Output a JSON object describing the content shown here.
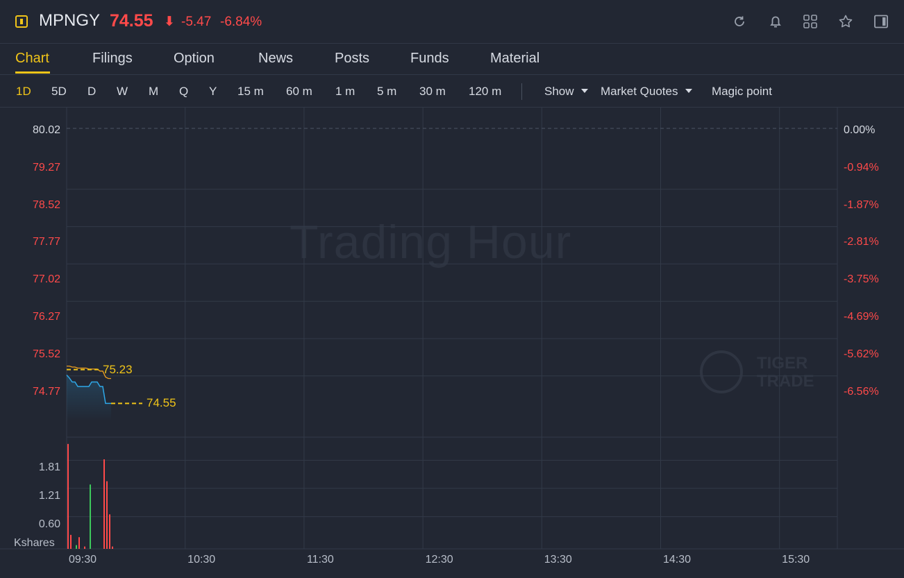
{
  "header": {
    "symbol": "MPNGY",
    "price": "74.55",
    "arrow": "⬇",
    "change": "-5.47",
    "change_pct": "-6.84%",
    "icons": [
      "refresh-icon",
      "bell-icon",
      "grid-icon",
      "star-icon",
      "panel-toggle-icon"
    ]
  },
  "tabs": [
    "Chart",
    "Filings",
    "Option",
    "News",
    "Posts",
    "Funds",
    "Material"
  ],
  "active_tab": "Chart",
  "periods": [
    "1D",
    "5D",
    "D",
    "W",
    "M",
    "Q",
    "Y",
    "15 m",
    "60 m",
    "1 m",
    "5 m",
    "30 m",
    "120 m"
  ],
  "active_period": "1D",
  "dropdowns": {
    "show": "Show",
    "market_quotes": "Market Quotes",
    "magic_point": "Magic point"
  },
  "watermark": "Trading Hour",
  "logo": {
    "line1": "TIGER",
    "line2": "TRADE"
  },
  "colors": {
    "accent": "#f0c419",
    "down": "#ff4a4a",
    "up": "#3ec95c",
    "price_line": "#2ea8e8",
    "avg_line": "#f0a020",
    "background": "#222733"
  },
  "chart_data": {
    "type": "line",
    "price_axis": {
      "labels": [
        "80.02",
        "79.27",
        "78.52",
        "77.77",
        "77.02",
        "76.27",
        "75.52",
        "74.77"
      ],
      "pct_labels": [
        "0.00%",
        "-0.94%",
        "-1.87%",
        "-2.81%",
        "-3.75%",
        "-4.69%",
        "-5.62%",
        "-6.56%"
      ],
      "reference_close": 80.02,
      "ylim": [
        74.45,
        80.3
      ]
    },
    "x_labels": [
      "09:30",
      "10:30",
      "11:30",
      "12:30",
      "13:30",
      "14:30",
      "15:30"
    ],
    "series": [
      {
        "name": "",
        "values": [
          75.12,
          75.06,
          74.98,
          74.98,
          74.89,
          74.89,
          74.89,
          74.89,
          74.89,
          74.98,
          74.98,
          74.98,
          74.89,
          74.89,
          74.55,
          74.55,
          74.55
        ],
        "last_label": "74.55"
      },
      {
        "name": "",
        "values": [
          75.3,
          75.3,
          75.28,
          75.28,
          75.26,
          75.26,
          75.26,
          75.26,
          75.24,
          75.24,
          75.24,
          75.24,
          75.2,
          75.2,
          75.08,
          75.05,
          75.05
        ],
        "last_label": "75.23"
      }
    ],
    "volume": {
      "unit_label": "Kshares",
      "labels": [
        "1.81",
        "1.21",
        "0.60"
      ],
      "ylim": [
        0,
        2.5
      ],
      "bars": [
        {
          "value": 2.25,
          "dir": "down"
        },
        {
          "value": 0.3,
          "dir": "down"
        },
        {
          "value": 0.0,
          "dir": "down"
        },
        {
          "value": 0.08,
          "dir": "up"
        },
        {
          "value": 0.25,
          "dir": "down"
        },
        {
          "value": 0.0,
          "dir": "down"
        },
        {
          "value": 0.05,
          "dir": "down"
        },
        {
          "value": 0.0,
          "dir": "down"
        },
        {
          "value": 1.38,
          "dir": "up"
        },
        {
          "value": 0.0,
          "dir": "down"
        },
        {
          "value": 0.0,
          "dir": "down"
        },
        {
          "value": 0.0,
          "dir": "down"
        },
        {
          "value": 0.0,
          "dir": "down"
        },
        {
          "value": 1.92,
          "dir": "down"
        },
        {
          "value": 1.45,
          "dir": "down"
        },
        {
          "value": 0.74,
          "dir": "down"
        },
        {
          "value": 0.05,
          "dir": "down"
        }
      ]
    },
    "grid": true
  }
}
